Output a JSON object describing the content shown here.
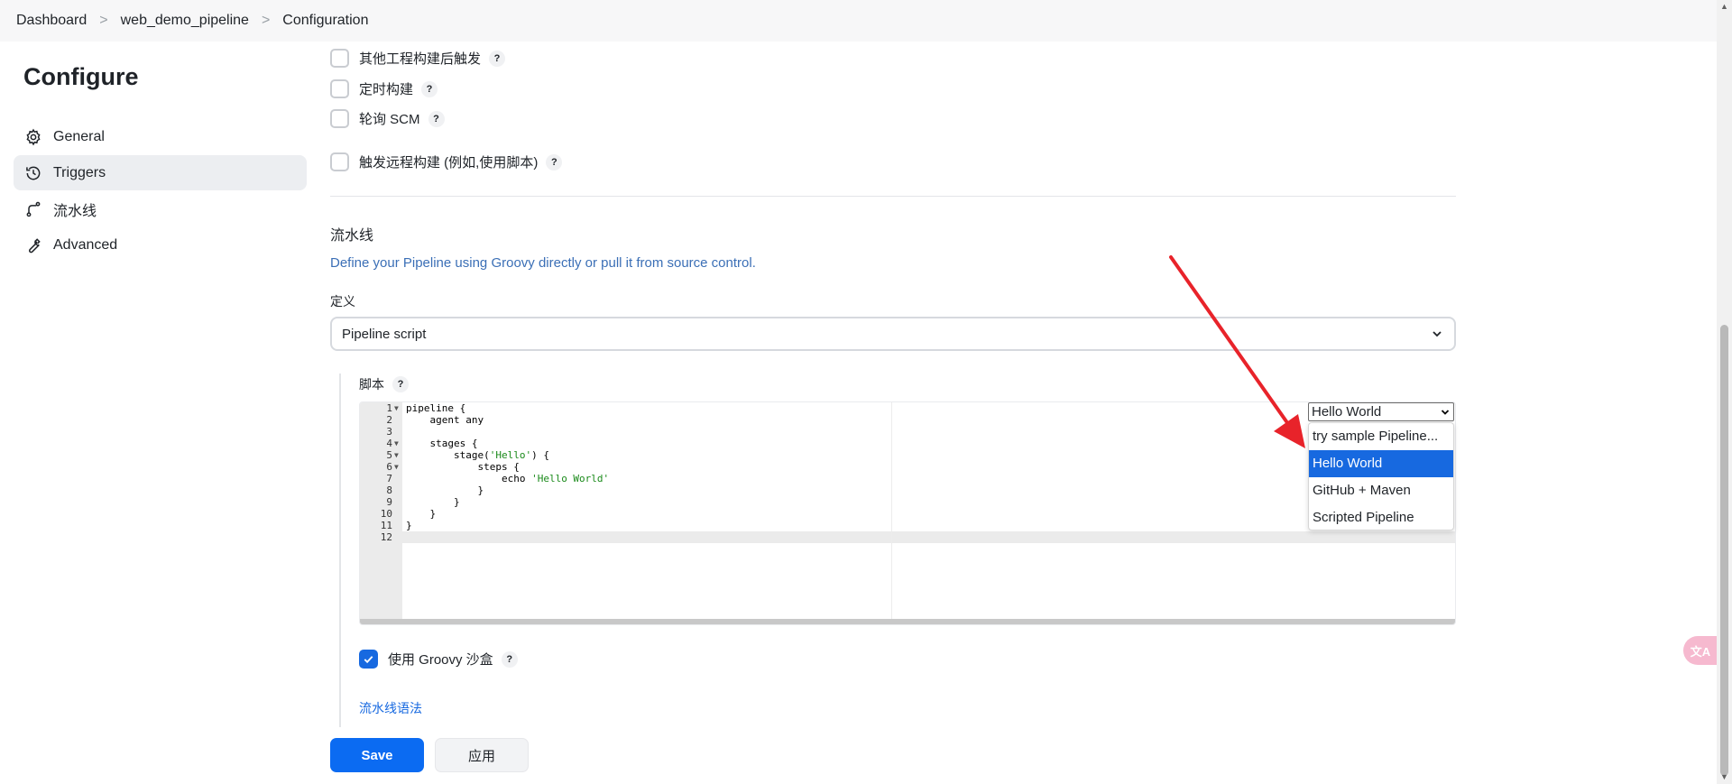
{
  "breadcrumb": {
    "items": [
      "Dashboard",
      "web_demo_pipeline",
      "Configuration"
    ],
    "separator": ">"
  },
  "sidebar": {
    "title": "Configure",
    "items": [
      {
        "label": "General",
        "icon": "gear-icon",
        "active": false
      },
      {
        "label": "Triggers",
        "icon": "clock-icon",
        "active": true
      },
      {
        "label": "流水线",
        "icon": "pipeline-icon",
        "active": false
      },
      {
        "label": "Advanced",
        "icon": "wrench-icon",
        "active": false
      }
    ]
  },
  "triggers": {
    "options": [
      {
        "label": "其他工程构建后触发",
        "checked": false
      },
      {
        "label": "定时构建",
        "checked": false
      },
      {
        "label": "轮询 SCM",
        "checked": false
      },
      {
        "label": "触发远程构建 (例如,使用脚本)",
        "checked": false
      }
    ]
  },
  "pipeline": {
    "section_title": "流水线",
    "description": "Define your Pipeline using Groovy directly or pull it from source control.",
    "definition_label": "定义",
    "definition_value": "Pipeline script",
    "script_label": "脚本",
    "code_lines": [
      {
        "n": "1",
        "fold": true,
        "text": "pipeline {"
      },
      {
        "n": "2",
        "fold": false,
        "text": "    agent any"
      },
      {
        "n": "3",
        "fold": false,
        "text": ""
      },
      {
        "n": "4",
        "fold": true,
        "text": "    stages {"
      },
      {
        "n": "5",
        "fold": true,
        "text": "        stage('Hello') {"
      },
      {
        "n": "6",
        "fold": true,
        "text": "            steps {"
      },
      {
        "n": "7",
        "fold": false,
        "text": "                echo 'Hello World'"
      },
      {
        "n": "8",
        "fold": false,
        "text": "            }"
      },
      {
        "n": "9",
        "fold": false,
        "text": "        }"
      },
      {
        "n": "10",
        "fold": false,
        "text": "    }"
      },
      {
        "n": "11",
        "fold": false,
        "text": "}"
      },
      {
        "n": "12",
        "fold": false,
        "text": ""
      }
    ],
    "sample_select_value": "Hello World",
    "sample_options": [
      "try sample Pipeline...",
      "Hello World",
      "GitHub + Maven",
      "Scripted Pipeline"
    ],
    "sample_selected_index": 1,
    "groovy_sandbox_label": "使用 Groovy 沙盒",
    "groovy_sandbox_checked": true,
    "syntax_link": "流水线语法"
  },
  "help_mark": "?",
  "buttons": {
    "save": "Save",
    "apply": "应用"
  },
  "translate_widget": "文A",
  "colors": {
    "accent": "#0b6bf2",
    "annotation_arrow": "#e8232a",
    "selected_option": "#1769e0"
  }
}
